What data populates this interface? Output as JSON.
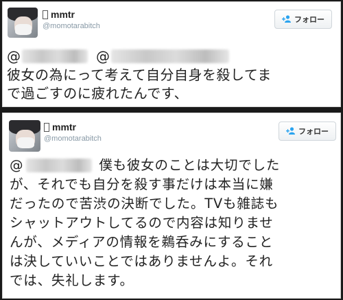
{
  "tweets": [
    {
      "user": {
        "name": "mmtr",
        "handle": "@momotarabitch"
      },
      "follow_label": "フォロー",
      "body_lines": [
        "彼女の為にって考えて自分自身を殺してま",
        "で過ごすのに疲れたんです、"
      ]
    },
    {
      "user": {
        "name": "mmtr",
        "handle": "@momotarabitch"
      },
      "follow_label": "フォロー",
      "body_lines": [
        "僕も彼女のことは大切でした",
        "が、それでも自分を殺す事だけは本当に嫌",
        "だったので苦渋の決断でした。TVも雑誌も",
        "シャットアウトしてるので内容は知りませ",
        "んが、メディアの情報を鵜呑みにすること",
        "は決していいことではありませんよ。それ",
        "では、失礼します。"
      ]
    }
  ],
  "colors": {
    "follow_icon": "#2aa3ef",
    "handle": "#8899a6",
    "text": "#222222",
    "background": "#1a1a1a"
  },
  "icons": {
    "follow": "person-add-icon",
    "name_prefix": "unknown-glyph-icon"
  }
}
